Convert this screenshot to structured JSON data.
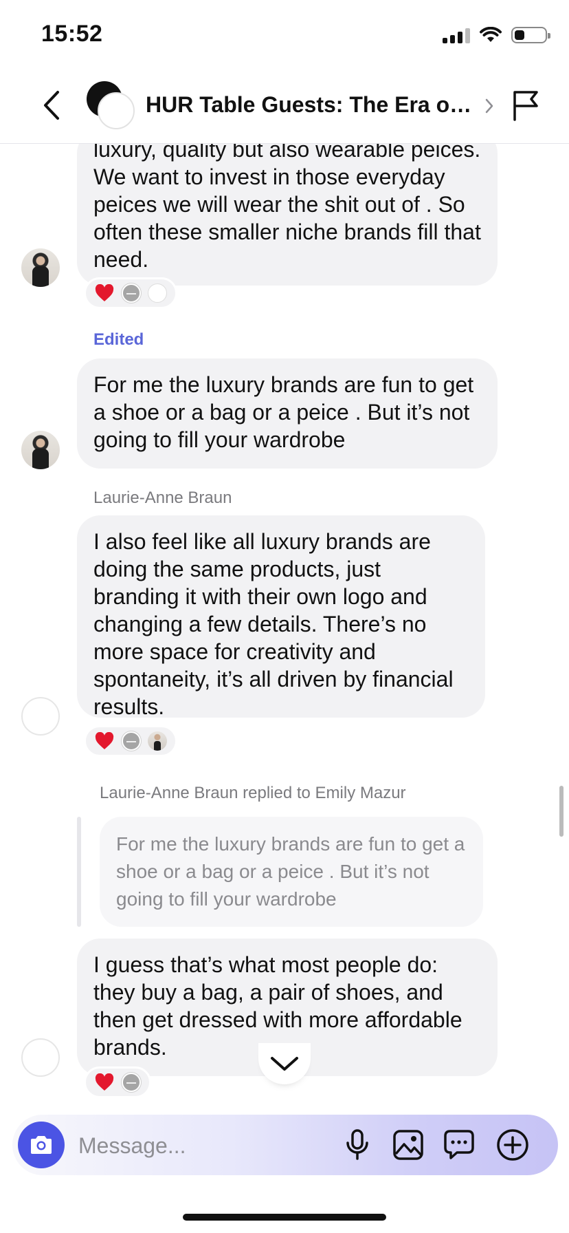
{
  "status_bar": {
    "time": "15:52"
  },
  "header": {
    "title": "HUR Table Guests: The Era of Quiet Luxury"
  },
  "messages": [
    {
      "text": "luxury, quality but also wearable peices. We want to invest in those everyday peices we will wear the shit out of . So often these smaller niche brands fill that need."
    },
    {
      "label": "Edited",
      "text": "For me the luxury brands are fun to get a shoe or a bag or a peice . But it’s not going to fill your wardrobe"
    },
    {
      "sender": "Laurie-Anne Braun",
      "text": "I also feel like all luxury brands are doing the same products, just branding it with their own logo and changing a few details. There’s no more space for creativity and spontaneity, it’s all driven by financial results."
    },
    {
      "reply_label": "Laurie-Anne Braun replied to Emily Mazur",
      "quoted_text": "For me the luxury brands are fun to get a shoe or a bag or a peice . But it’s not going to fill your wardrobe",
      "text": "I guess that’s what most people do: they buy a bag, a pair of shoes, and then get dressed with more affordable brands."
    }
  ],
  "composer": {
    "placeholder": "Message..."
  },
  "icons": [
    "back-chevron-icon",
    "title-chevron-icon",
    "flag-icon",
    "heart-reaction-icon",
    "scroll-down-chevron-icon",
    "camera-icon",
    "microphone-icon",
    "image-icon",
    "chat-bubble-icon",
    "plus-circle-icon"
  ],
  "colors": {
    "accent": "#4b54e4",
    "edited": "#5a66d8",
    "bubble": "#f2f2f4"
  }
}
